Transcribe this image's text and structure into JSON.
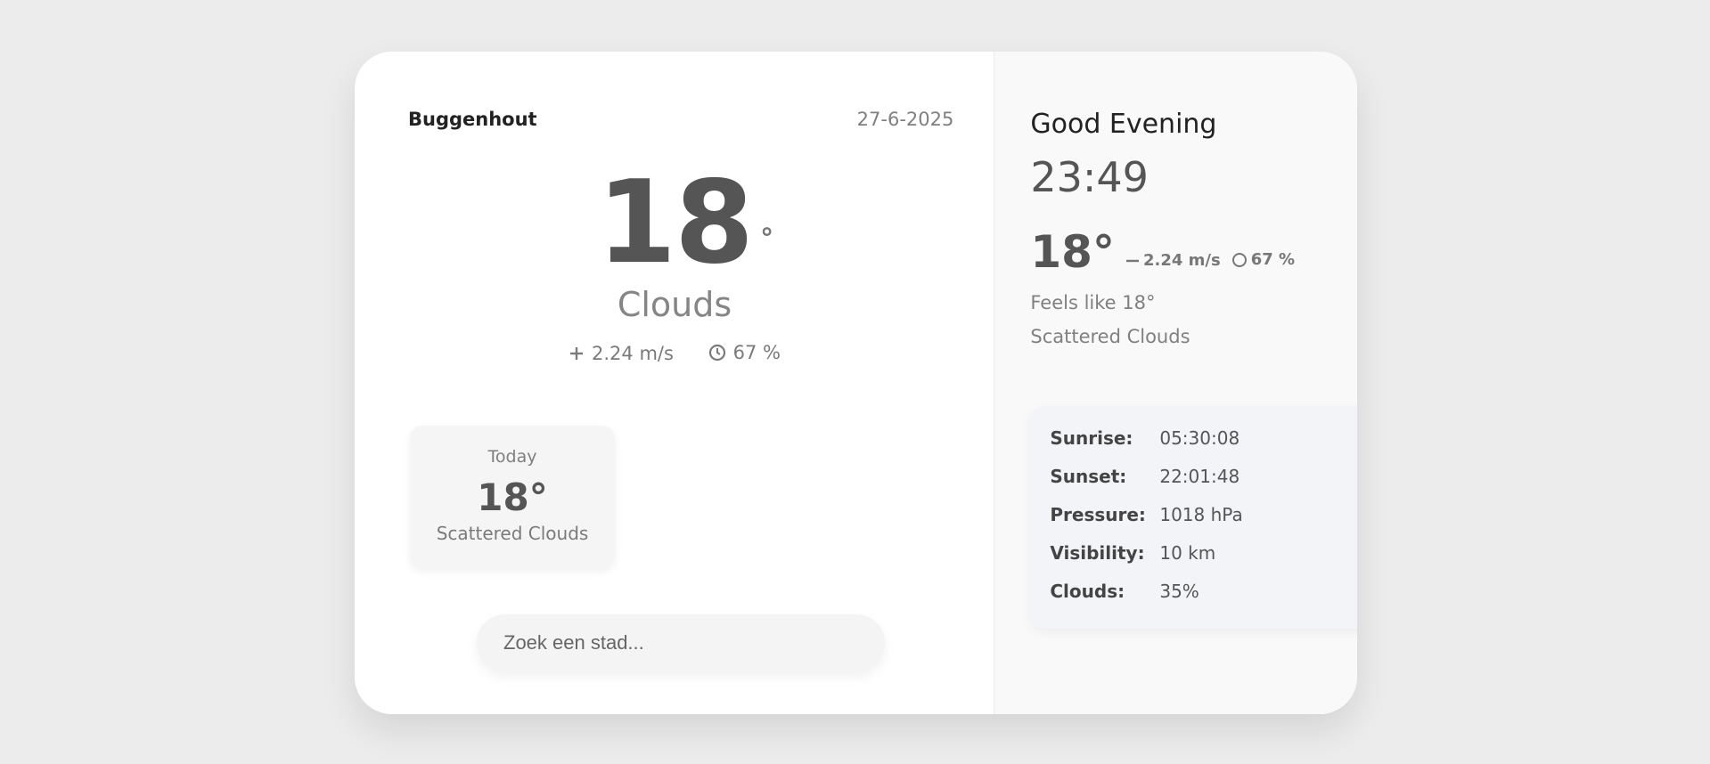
{
  "location": {
    "city": "Buggenhout",
    "date": "27-6-2025"
  },
  "current": {
    "temp": "18",
    "degree_symbol": "°",
    "condition": "Clouds",
    "wind": "2.24 m/s",
    "humidity": "67 %"
  },
  "forecast": {
    "label": "Today",
    "temp": "18°",
    "description": "Scattered Clouds"
  },
  "search": {
    "placeholder": "Zoek een stad..."
  },
  "sidebar": {
    "greeting": "Good Evening",
    "time": "23:49",
    "temp": "18°",
    "wind": "2.24 m/s",
    "humidity": "67 %",
    "feels_like": "Feels like 18°",
    "description": "Scattered Clouds",
    "details": [
      {
        "key": "Sunrise:",
        "value": "05:30:08"
      },
      {
        "key": "Sunset:",
        "value": "22:01:48"
      },
      {
        "key": "Pressure:",
        "value": "1018 hPa"
      },
      {
        "key": "Visibility:",
        "value": "10 km"
      },
      {
        "key": "Clouds:",
        "value": "35%"
      }
    ]
  },
  "icons": {
    "wind": "wind-icon",
    "humidity": "humidity-icon"
  },
  "colors": {
    "background": "#ececec",
    "card": "#ffffff",
    "sidebar": "#f9f9f9",
    "details_panel": "#f3f4f7",
    "primary_text": "#555555",
    "muted_text": "#808080"
  }
}
